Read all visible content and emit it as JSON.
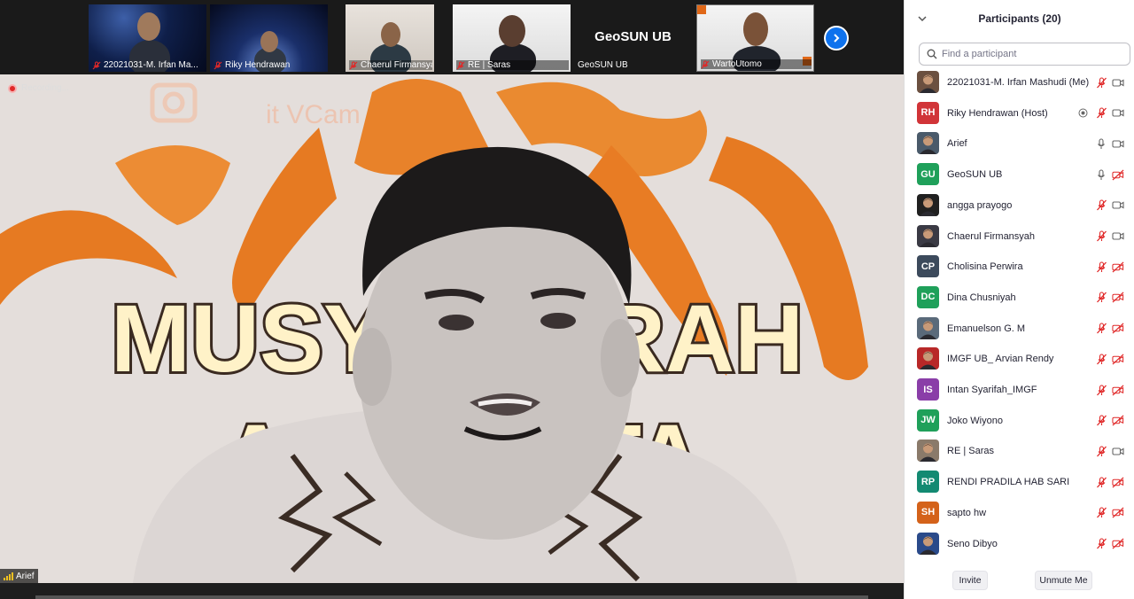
{
  "thumbnails": [
    {
      "name": "22021031-M. Irfan Ma...",
      "muted": true,
      "bg": "space"
    },
    {
      "name": "Riky Hendrawan",
      "muted": true,
      "bg": "space2"
    },
    {
      "name": "Chaerul Firmansyah",
      "muted": true,
      "bg": "wall"
    },
    {
      "name": "RE | Saras",
      "muted": true,
      "bg": "white"
    },
    {
      "name": "GeoSUN UB",
      "center_name": "GeoSUN UB",
      "muted": false,
      "bg": "dark"
    },
    {
      "name": "WartoUtomo",
      "muted": true,
      "bg": "white"
    }
  ],
  "main_video": {
    "speaker": "Arief",
    "recording_label": "Recording...",
    "background_text": [
      "MUSYAWARAH",
      "ANGGOTA"
    ],
    "watermark": "it VCam"
  },
  "panel": {
    "title": "Participants (20)",
    "search_placeholder": "Find a participant",
    "participants": [
      {
        "name": "22021031-M. Irfan Mashudi (Me)",
        "avatar_type": "photo",
        "avatar_color": "#6b5040",
        "mic": "muted",
        "video": "on"
      },
      {
        "name": "Riky Hendrawan (Host)",
        "initials": "RH",
        "avatar_type": "initials",
        "avatar_color": "#d13438",
        "mic": "muted",
        "video": "on",
        "recording": true
      },
      {
        "name": "Arief",
        "avatar_type": "photo",
        "avatar_color": "#4a5a6a",
        "mic": "on",
        "video": "on"
      },
      {
        "name": "GeoSUN UB",
        "initials": "GU",
        "avatar_type": "initials",
        "avatar_color": "#1fa05a",
        "mic": "on",
        "video": "off"
      },
      {
        "name": "angga prayogo",
        "avatar_type": "photo",
        "avatar_color": "#202020",
        "mic": "muted",
        "video": "on"
      },
      {
        "name": "Chaerul Firmansyah",
        "avatar_type": "photo",
        "avatar_color": "#3a3a44",
        "mic": "muted",
        "video": "on"
      },
      {
        "name": "Cholisina Perwira",
        "initials": "CP",
        "avatar_type": "initials",
        "avatar_color": "#3c4a5c",
        "mic": "muted",
        "video": "off"
      },
      {
        "name": "Dina Chusniyah",
        "initials": "DC",
        "avatar_type": "initials",
        "avatar_color": "#1fa05a",
        "mic": "muted",
        "video": "off"
      },
      {
        "name": "Emanuelson G. M",
        "avatar_type": "photo",
        "avatar_color": "#5a6a7a",
        "mic": "muted",
        "video": "off"
      },
      {
        "name": "IMGF UB_ Arvian Rendy",
        "avatar_type": "photo",
        "avatar_color": "#b82828",
        "mic": "muted",
        "video": "off"
      },
      {
        "name": "Intan Syarifah_IMGF",
        "initials": "IS",
        "avatar_type": "initials",
        "avatar_color": "#8a3ea8",
        "mic": "muted",
        "video": "off"
      },
      {
        "name": "Joko Wiyono",
        "initials": "JW",
        "avatar_type": "initials",
        "avatar_color": "#1fa05a",
        "mic": "muted",
        "video": "off"
      },
      {
        "name": "RE | Saras",
        "avatar_type": "photo",
        "avatar_color": "#8a7a6a",
        "mic": "muted",
        "video": "on"
      },
      {
        "name": "RENDI PRADILA HAB SARI",
        "initials": "RP",
        "avatar_type": "initials",
        "avatar_color": "#138a72",
        "mic": "muted",
        "video": "off"
      },
      {
        "name": "sapto hw",
        "initials": "SH",
        "avatar_type": "initials",
        "avatar_color": "#d4621a",
        "mic": "muted",
        "video": "off"
      },
      {
        "name": "Seno Dibyo",
        "avatar_type": "photo",
        "avatar_color": "#2a4a8a",
        "mic": "muted",
        "video": "off"
      }
    ],
    "footer": {
      "invite_label": "Invite",
      "unmute_label": "Unmute Me"
    }
  },
  "colors": {
    "accent": "#0e72ed",
    "muted_red": "#e02828",
    "panel_text": "#232333"
  }
}
